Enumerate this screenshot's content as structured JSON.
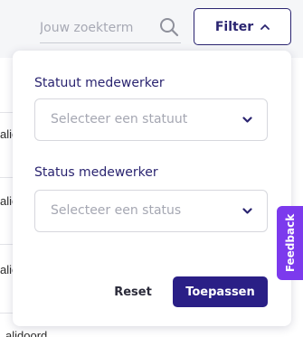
{
  "search": {
    "placeholder": "Jouw zoekterm",
    "icon": "search-icon"
  },
  "filter_button": {
    "label": "Filter",
    "icon": "chevron-up-icon"
  },
  "filter_panel": {
    "statute": {
      "label": "Statuut medewerker",
      "placeholder": "Selecteer een statuut",
      "icon": "chevron-down-icon"
    },
    "status": {
      "label": "Status medewerker",
      "placeholder": "Selecteer een status",
      "icon": "chevron-down-icon"
    },
    "reset_label": "Reset",
    "apply_label": "Toepassen"
  },
  "background_rows": [
    "alic",
    "alic",
    "alic",
    "alidoord"
  ],
  "feedback_tab": {
    "label": "Feedback"
  },
  "colors": {
    "primary": "#2a2470",
    "apply_button": "#2a1f86",
    "feedback": "#7c3aed",
    "placeholder": "#a5a7b2"
  }
}
